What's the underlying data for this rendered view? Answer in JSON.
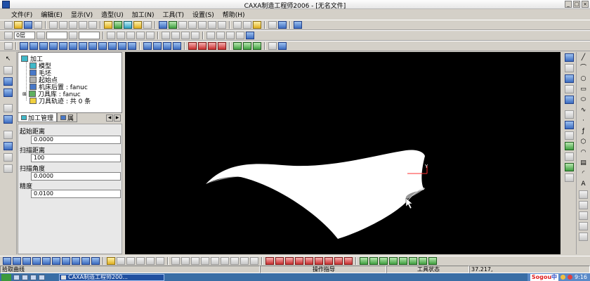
{
  "window": {
    "title": "CAXA制造工程师2006 - [无名文件]",
    "controls": [
      "_",
      "□",
      "×"
    ]
  },
  "menu": [
    "文件(F)",
    "编辑(E)",
    "显示(V)",
    "造型(U)",
    "加工(N)",
    "工具(T)",
    "设置(S)",
    "帮助(H)"
  ],
  "toolbar_fields": {
    "layer": "0层",
    "color": "",
    "linetype": ""
  },
  "tree": {
    "root": "加工",
    "children": [
      "模型",
      "毛坯",
      "起始点",
      "机床后置 : fanuc",
      "刀具库 : fanuc",
      "刀具轨迹 : 共 0 条"
    ]
  },
  "panel_tabs": {
    "active": "加工管理",
    "inactive": "属"
  },
  "params": [
    {
      "label": "起始距离",
      "value": "0.0000"
    },
    {
      "label": "扫描距离",
      "value": "100"
    },
    {
      "label": "扫描角度",
      "value": "0.0000"
    },
    {
      "label": "精度",
      "value": "0.0100"
    }
  ],
  "viewport": {
    "background": "#000000",
    "surface_color": "#ffffff",
    "axis_labels": [
      "Y",
      "X"
    ]
  },
  "status": {
    "prompt": "拾取曲线",
    "operation": "操作指导",
    "tool_state": "工具状态",
    "coords": "37.217,"
  },
  "taskbar": {
    "task_label": "CAXA制造工程师200...",
    "ime_brand": "Sogou",
    "ime_zh": "中",
    "clock": "9:16"
  }
}
